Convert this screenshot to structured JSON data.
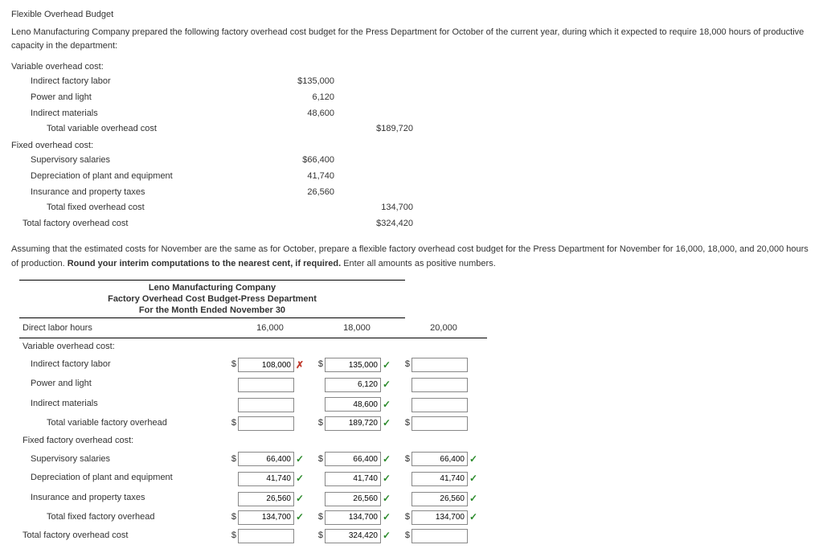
{
  "title": "Flexible Overhead Budget",
  "intro": "Leno Manufacturing Company prepared the following factory overhead cost budget for the Press Department for October of the current year, during which it expected to require 18,000 hours of productive capacity in the department:",
  "budget": {
    "var_head": "Variable overhead cost:",
    "items_var": [
      {
        "label": "Indirect factory labor",
        "amt": "$135,000"
      },
      {
        "label": "Power and light",
        "amt": "6,120"
      },
      {
        "label": "Indirect materials",
        "amt": "48,600"
      }
    ],
    "var_total_label": "Total variable overhead cost",
    "var_total": "$189,720",
    "fix_head": "Fixed overhead cost:",
    "items_fix": [
      {
        "label": "Supervisory salaries",
        "amt": "$66,400"
      },
      {
        "label": "Depreciation of plant and equipment",
        "amt": "41,740"
      },
      {
        "label": "Insurance and property taxes",
        "amt": "26,560"
      }
    ],
    "fix_total_label": "Total fixed overhead cost",
    "fix_total": "134,700",
    "grand_label": "Total factory overhead cost",
    "grand": "$324,420"
  },
  "mid_text": "Assuming that the estimated costs for November are the same as for October, prepare a flexible factory overhead cost budget for the Press Department for November for 16,000, 18,000, and 20,000 hours of production. Round your interim computations to the nearest cent, if required. Enter all amounts as positive numbers.",
  "report_head": {
    "l1": "Leno Manufacturing Company",
    "l2": "Factory Overhead Cost Budget-Press Department",
    "l3": "For the Month Ended November 30"
  },
  "flex": {
    "hours_label": "Direct labor hours",
    "hours": [
      "16,000",
      "18,000",
      "20,000"
    ],
    "rows": [
      {
        "label": "Variable overhead cost:",
        "kind": "head"
      },
      {
        "label": "Indirect factory labor",
        "indent": 1,
        "d": [
          true,
          true,
          true
        ],
        "v": [
          "108,000",
          "135,000",
          ""
        ],
        "mark": [
          "bad",
          "ok",
          ""
        ]
      },
      {
        "label": "Power and light",
        "indent": 1,
        "d": [
          false,
          false,
          false
        ],
        "v": [
          "",
          "6,120",
          ""
        ],
        "mark": [
          "",
          "ok",
          ""
        ]
      },
      {
        "label": "Indirect materials",
        "indent": 1,
        "d": [
          false,
          false,
          false
        ],
        "v": [
          "",
          "48,600",
          ""
        ],
        "mark": [
          "",
          "ok",
          ""
        ]
      },
      {
        "label": "Total variable factory overhead",
        "indent": 2,
        "d": [
          true,
          true,
          true
        ],
        "v": [
          "",
          "189,720",
          ""
        ],
        "mark": [
          "",
          "ok",
          ""
        ]
      },
      {
        "label": "Fixed factory overhead cost:",
        "kind": "head"
      },
      {
        "label": "Supervisory salaries",
        "indent": 1,
        "d": [
          true,
          true,
          true
        ],
        "v": [
          "66,400",
          "66,400",
          "66,400"
        ],
        "mark": [
          "ok",
          "ok",
          "ok"
        ]
      },
      {
        "label": "Depreciation of plant and equipment",
        "indent": 1,
        "d": [
          false,
          false,
          false
        ],
        "v": [
          "41,740",
          "41,740",
          "41,740"
        ],
        "mark": [
          "ok",
          "ok",
          "ok"
        ]
      },
      {
        "label": "Insurance and property taxes",
        "indent": 1,
        "d": [
          false,
          false,
          false
        ],
        "v": [
          "26,560",
          "26,560",
          "26,560"
        ],
        "mark": [
          "ok",
          "ok",
          "ok"
        ]
      },
      {
        "label": "Total fixed factory overhead",
        "indent": 2,
        "d": [
          true,
          true,
          true
        ],
        "v": [
          "134,700",
          "134,700",
          "134,700"
        ],
        "mark": [
          "ok",
          "ok",
          "ok"
        ]
      },
      {
        "label": "Total factory overhead cost",
        "indent": 0,
        "d": [
          true,
          true,
          true
        ],
        "v": [
          "",
          "324,420",
          ""
        ],
        "mark": [
          "",
          "ok",
          ""
        ]
      }
    ]
  }
}
